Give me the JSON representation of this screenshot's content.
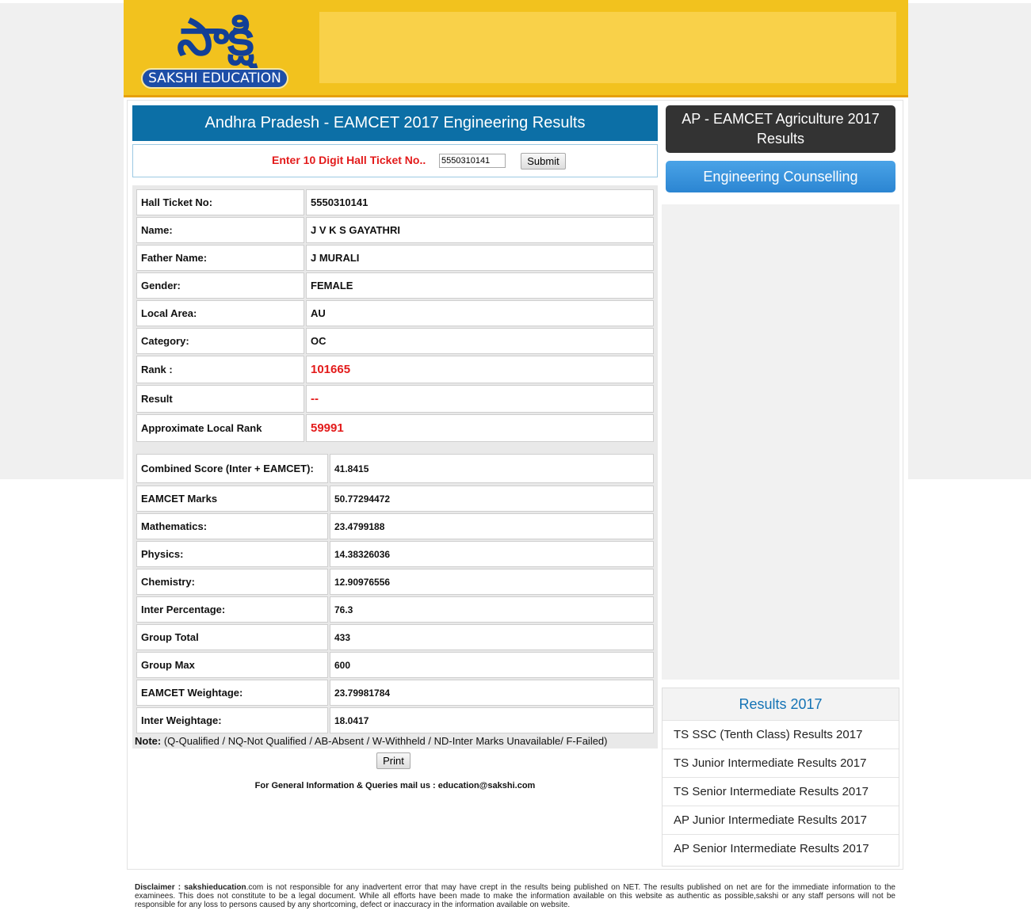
{
  "brand": {
    "logo_script": "సాక్షి",
    "logo_text": "SAKSHI EDUCATION"
  },
  "main": {
    "title": "Andhra Pradesh - EAMCET 2017 Engineering Results",
    "ticket_label": "Enter 10 Digit Hall Ticket No..",
    "ticket_value": "5550310141",
    "submit_label": "Submit"
  },
  "candidate": [
    {
      "label": "Hall Ticket No:",
      "value": "5550310141"
    },
    {
      "label": "Name:",
      "value": "J V K S GAYATHRI"
    },
    {
      "label": "Father Name:",
      "value": "J MURALI"
    },
    {
      "label": "Gender:",
      "value": "FEMALE"
    },
    {
      "label": "Local Area:",
      "value": "AU"
    },
    {
      "label": "Category:",
      "value": "OC"
    },
    {
      "label": "Rank :",
      "value": "101665"
    },
    {
      "label": "Result",
      "value": "--"
    },
    {
      "label": "Approximate Local Rank",
      "value": "59991"
    }
  ],
  "scores": [
    {
      "label": "Combined Score (Inter + EAMCET):",
      "value": "41.8415"
    },
    {
      "label": "EAMCET Marks",
      "value": "50.77294472"
    },
    {
      "label": "Mathematics:",
      "value": "23.4799188"
    },
    {
      "label": "Physics:",
      "value": "14.38326036"
    },
    {
      "label": "Chemistry:",
      "value": "12.90976556"
    },
    {
      "label": "Inter Percentage:",
      "value": "76.3"
    },
    {
      "label": "Group Total",
      "value": "433"
    },
    {
      "label": "Group Max",
      "value": "600"
    },
    {
      "label": "EAMCET Weightage:",
      "value": "23.79981784"
    },
    {
      "label": "Inter Weightage:",
      "value": "18.0417"
    }
  ],
  "note": {
    "label": "Note:",
    "text": " (Q-Qualified / NQ-Not Qualified / AB-Absent / W-Withheld / ND-Inter Marks Unavailable/ F-Failed)"
  },
  "print_label": "Print",
  "mail_info": "For General Information & Queries mail us : education@sakshi.com",
  "sidebar": {
    "agri_button": "AP - EAMCET Agriculture 2017 Results",
    "counselling_button": "Engineering Counselling",
    "results_heading": "Results 2017",
    "results_links": [
      "TS SSC (Tenth Class) Results 2017",
      "TS Junior Intermediate Results 2017",
      "TS Senior Intermediate Results 2017",
      "AP Junior Intermediate Results 2017",
      "AP Senior Intermediate Results 2017"
    ]
  },
  "disclaimer": {
    "label": "Disclaimer : ",
    "site": "sakshieducation",
    "text": ".com is not responsible for any inadvertent error that may have crept in the results being published on NET. The results published on net are for the immediate information to the examinees. This does not constitute to be a legal document. While all efforts have been made to make the information available on this website as authentic as possible,sakshi or any staff persons will not be responsible for any loss to persons caused by any shortcoming, defect or inaccuracy in the information available on website."
  },
  "colors": {
    "header_yellow": "#f2c21e",
    "title_blue": "#0c6fa6",
    "highlight_red": "#e31b1b",
    "link_blue": "#1473b5"
  }
}
